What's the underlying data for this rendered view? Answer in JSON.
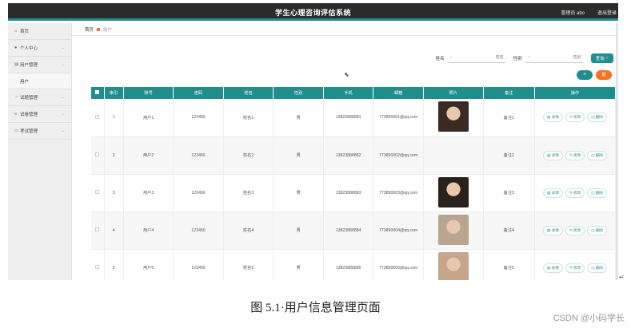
{
  "app": {
    "title": "学生心理咨询评估系统",
    "admin_label": "管理员 abo",
    "logout_label": "退出登录"
  },
  "sidebar": {
    "items": [
      {
        "icon": "home-icon",
        "glyph": "⌂",
        "label": "首页"
      },
      {
        "icon": "user-icon",
        "glyph": "●",
        "label": "个人中心"
      },
      {
        "icon": "users-icon",
        "glyph": "▤",
        "label": "用户管理"
      },
      {
        "icon": "grid-icon",
        "glyph": "⁘",
        "label": "试题管理"
      },
      {
        "icon": "list-icon",
        "glyph": "≡",
        "label": "试卷管理"
      },
      {
        "icon": "book-icon",
        "glyph": "▭",
        "label": "考试管理"
      }
    ],
    "sub_item": "用户"
  },
  "breadcrumb": {
    "home": "首页",
    "current": "用户"
  },
  "search": {
    "name_label": "姓名",
    "name_placeholder": "姓名",
    "gender_label": "性别",
    "gender_placeholder": "性别",
    "query_button": "查询"
  },
  "actions": {
    "add": "+",
    "delete": "删"
  },
  "table": {
    "headers": [
      "索引",
      "账号",
      "密码",
      "姓名",
      "性别",
      "手机",
      "邮箱",
      "照片",
      "备注",
      "操作"
    ],
    "rows": [
      {
        "idx": "1",
        "account": "用户1",
        "password": "123456",
        "name": "姓名1",
        "gender": "男",
        "phone": "13823888881",
        "email": "773890001@qq.com",
        "has_photo": true,
        "note": "备注1"
      },
      {
        "idx": "2",
        "account": "用户2",
        "password": "123456",
        "name": "姓名2",
        "gender": "男",
        "phone": "13823888882",
        "email": "773890002@qq.com",
        "has_photo": false,
        "note": "备注2"
      },
      {
        "idx": "3",
        "account": "用户3",
        "password": "123456",
        "name": "姓名3",
        "gender": "男",
        "phone": "13823888883",
        "email": "773890003@qq.com",
        "has_photo": true,
        "note": "备注3"
      },
      {
        "idx": "4",
        "account": "用户4",
        "password": "123456",
        "name": "姓名4",
        "gender": "男",
        "phone": "13823888884",
        "email": "773890004@qq.com",
        "has_photo": true,
        "note": "备注4"
      },
      {
        "idx": "5",
        "account": "用户5",
        "password": "123456",
        "name": "姓名5",
        "gender": "男",
        "phone": "13823888885",
        "email": "773890005@qq.com",
        "has_photo": true,
        "note": "备注5"
      }
    ],
    "op_labels": {
      "detail": "详情",
      "edit": "修改",
      "delete": "删除"
    }
  },
  "caption": "图 5.1·用户信息管理页面",
  "watermark": "CSDN @小码学长",
  "colors": {
    "accent": "#1f8f8d",
    "danger": "#f47321",
    "topbar": "#2b2b2b"
  }
}
